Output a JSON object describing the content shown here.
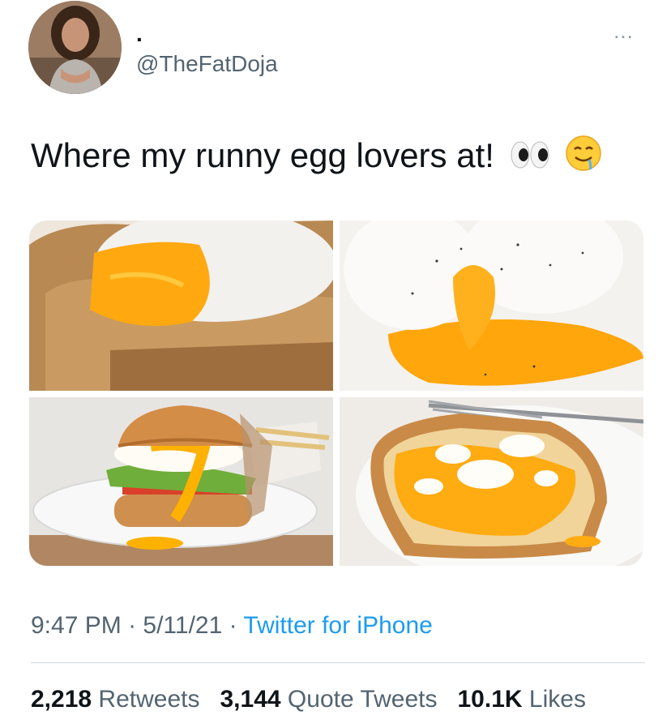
{
  "author": {
    "display_name": ".",
    "handle": "@TheFatDoja"
  },
  "tweet": {
    "text": "Where my runny egg lovers at!",
    "emojis": [
      "eyes-emoji",
      "drooling-face-emoji"
    ]
  },
  "media": [
    {
      "name": "poached-egg-on-toast-photo"
    },
    {
      "name": "soft-boiled-egg-photo"
    },
    {
      "name": "egg-burger-photo"
    },
    {
      "name": "egg-on-toast-photo"
    }
  ],
  "meta": {
    "time": "9:47 PM",
    "separator": " · ",
    "date": "5/11/21",
    "source": "Twitter for iPhone"
  },
  "stats": {
    "retweets_count": "2,218",
    "retweets_label": "Retweets",
    "quotes_count": "3,144",
    "quotes_label": "Quote Tweets",
    "likes_count": "10.1K",
    "likes_label": "Likes"
  },
  "more_icon": "…",
  "colors": {
    "link": "#1d9bf0",
    "muted": "#536471",
    "text": "#0f1419"
  }
}
